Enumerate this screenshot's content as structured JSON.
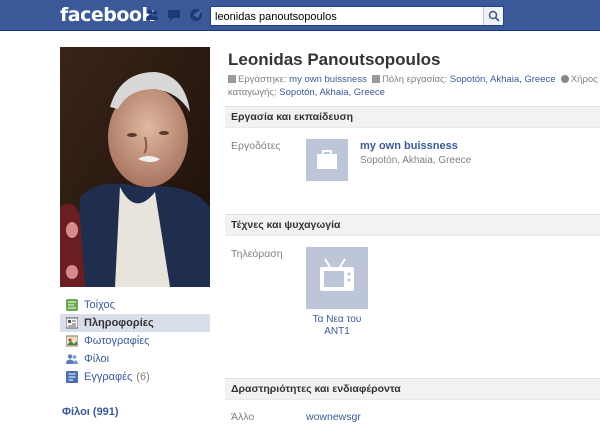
{
  "topbar": {
    "logo": "facebook",
    "search": {
      "value": "leonidas panoutsopoulos"
    }
  },
  "sidebar": {
    "items": [
      {
        "label": "Τοίχος",
        "icon": "wall-icon",
        "active": false
      },
      {
        "label": "Πληροφορίες",
        "icon": "info-icon",
        "active": true
      },
      {
        "label": "Φωτογραφίες",
        "icon": "photos-icon",
        "active": false
      },
      {
        "label": "Φίλοι",
        "icon": "friends-icon",
        "active": false
      },
      {
        "label": "Εγγραφές",
        "icon": "notes-icon",
        "active": false,
        "count": "(6)"
      }
    ],
    "friends_link": "Φίλοι (991)"
  },
  "profile": {
    "name": "Leonidas Panoutsopoulos",
    "info": {
      "works_label": "Εργάστηκε:",
      "works_value": "my own buissness",
      "city_label": "Πόλη εργασίας:",
      "city_value": "Sopotón, Akhaia, Greece",
      "status_label": "Χήρος",
      "origin_label": "καταγωγής:",
      "origin_value": "Sopotón, Akhaia, Greece"
    }
  },
  "sections": {
    "work": {
      "title": "Εργασία και εκπαίδευση",
      "employers_label": "Εργοδότες",
      "employer_name": "my own buissness",
      "employer_location": "Sopotón, Akhaia, Greece"
    },
    "arts": {
      "title": "Τέχνες και ψυχαγωγία",
      "tv_label": "Τηλεόραση",
      "tv_show_line1": "Τα Νεα του",
      "tv_show_line2": "ANT1"
    },
    "activities": {
      "title": "Δραστηριότητες και ενδιαφέροντα",
      "other_label": "Άλλο",
      "other_value": "wownewsgr"
    }
  },
  "colors": {
    "brand_blue": "#3b5998",
    "tile_gray": "#bcc6d8",
    "active_nav": "#d8dfea"
  }
}
